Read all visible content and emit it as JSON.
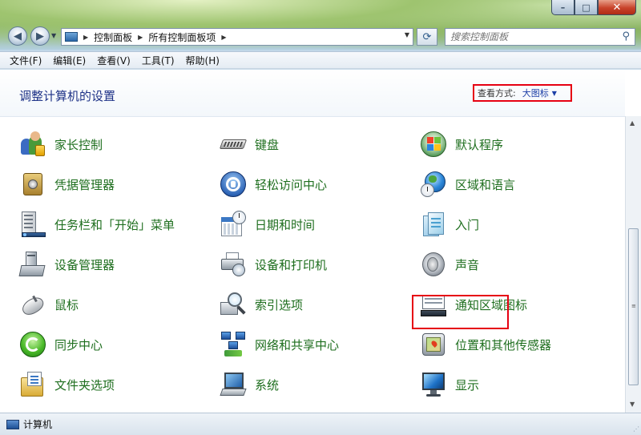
{
  "window": {
    "caption": {
      "min": "–",
      "max": "□",
      "close": "✕"
    }
  },
  "nav": {
    "back_icon": "back-arrow-icon",
    "forward_icon": "forward-arrow-icon",
    "breadcrumbs": [
      "控制面板",
      "所有控制面板项"
    ],
    "search_placeholder": "搜索控制面板"
  },
  "menu": [
    "文件(F)",
    "编辑(E)",
    "查看(V)",
    "工具(T)",
    "帮助(H)"
  ],
  "header": {
    "title": "调整计算机的设置",
    "view_by_label": "查看方式:",
    "view_by_value": "大图标"
  },
  "items": [
    {
      "label": "家长控制",
      "icon": "parental-controls-icon"
    },
    {
      "label": "键盘",
      "icon": "keyboard-icon"
    },
    {
      "label": "默认程序",
      "icon": "default-programs-icon"
    },
    {
      "label": "凭据管理器",
      "icon": "credential-manager-icon"
    },
    {
      "label": "轻松访问中心",
      "icon": "ease-of-access-icon"
    },
    {
      "label": "区域和语言",
      "icon": "region-language-icon"
    },
    {
      "label": "任务栏和「开始」菜单",
      "icon": "taskbar-start-menu-icon"
    },
    {
      "label": "日期和时间",
      "icon": "date-time-icon"
    },
    {
      "label": "入门",
      "icon": "getting-started-icon"
    },
    {
      "label": "设备管理器",
      "icon": "device-manager-icon"
    },
    {
      "label": "设备和打印机",
      "icon": "devices-printers-icon"
    },
    {
      "label": "声音",
      "icon": "sound-icon"
    },
    {
      "label": "鼠标",
      "icon": "mouse-icon"
    },
    {
      "label": "索引选项",
      "icon": "indexing-options-icon"
    },
    {
      "label": "通知区域图标",
      "icon": "notification-area-icon"
    },
    {
      "label": "同步中心",
      "icon": "sync-center-icon"
    },
    {
      "label": "网络和共享中心",
      "icon": "network-sharing-icon"
    },
    {
      "label": "位置和其他传感器",
      "icon": "location-sensors-icon"
    },
    {
      "label": "文件夹选项",
      "icon": "folder-options-icon"
    },
    {
      "label": "系统",
      "icon": "system-icon"
    },
    {
      "label": "显示",
      "icon": "display-icon"
    }
  ],
  "status": {
    "text": "计算机"
  },
  "colors": {
    "link_green": "#1e6e1e",
    "title_blue": "#1e3287",
    "highlight_red": "#e60012"
  }
}
